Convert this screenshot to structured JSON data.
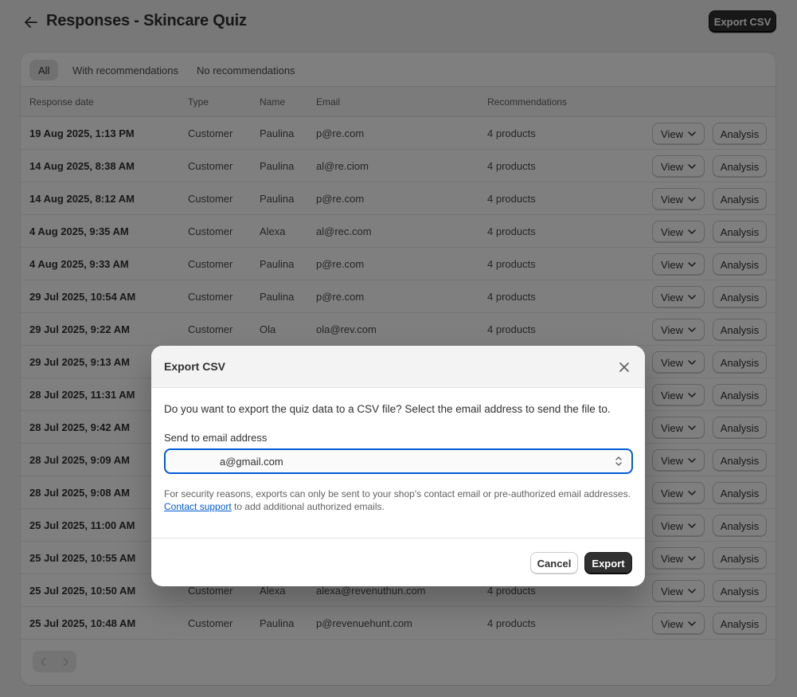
{
  "header": {
    "title": "Responses - Skincare Quiz",
    "export_label": "Export CSV"
  },
  "tabs": [
    "All",
    "With recommendations",
    "No recommendations"
  ],
  "columns": [
    "Response date",
    "Type",
    "Name",
    "Email",
    "Recommendations"
  ],
  "row_actions": {
    "view_label": "View",
    "analysis_label": "Analysis"
  },
  "rows": [
    {
      "date": "19 Aug 2025, 1:13 PM",
      "type": "Customer",
      "name": "Paulina",
      "email": "p@re.com",
      "recs": "4 products"
    },
    {
      "date": "14 Aug 2025, 8:38 AM",
      "type": "Customer",
      "name": "Paulina",
      "email": "al@re.ciom",
      "recs": "4 products"
    },
    {
      "date": "14 Aug 2025, 8:12 AM",
      "type": "Customer",
      "name": "Paulina",
      "email": "p@re.com",
      "recs": "4 products"
    },
    {
      "date": "4 Aug 2025, 9:35 AM",
      "type": "Customer",
      "name": "Alexa",
      "email": "al@rec.com",
      "recs": "4 products"
    },
    {
      "date": "4 Aug 2025, 9:33 AM",
      "type": "Customer",
      "name": "Paulina",
      "email": "p@re.com",
      "recs": "4 products"
    },
    {
      "date": "29 Jul 2025, 10:54 AM",
      "type": "Customer",
      "name": "Paulina",
      "email": "p@re.com",
      "recs": "4 products"
    },
    {
      "date": "29 Jul 2025, 9:22 AM",
      "type": "Customer",
      "name": "Ola",
      "email": "ola@rev.com",
      "recs": "4 products"
    },
    {
      "date": "29 Jul 2025, 9:13 AM",
      "type": "",
      "name": "",
      "email": "",
      "recs": ""
    },
    {
      "date": "28 Jul 2025, 11:31 AM",
      "type": "",
      "name": "",
      "email": "",
      "recs": ""
    },
    {
      "date": "28 Jul 2025, 9:42 AM",
      "type": "",
      "name": "",
      "email": "",
      "recs": ""
    },
    {
      "date": "28 Jul 2025, 9:09 AM",
      "type": "",
      "name": "",
      "email": "",
      "recs": ""
    },
    {
      "date": "28 Jul 2025, 9:08 AM",
      "type": "",
      "name": "",
      "email": "",
      "recs": ""
    },
    {
      "date": "25 Jul 2025, 11:00 AM",
      "type": "",
      "name": "",
      "email": "",
      "recs": ""
    },
    {
      "date": "25 Jul 2025, 10:55 AM",
      "type": "",
      "name": "",
      "email": "",
      "recs": ""
    },
    {
      "date": "25 Jul 2025, 10:50 AM",
      "type": "Customer",
      "name": "Alexa",
      "email": "alexa@revenuthun.com",
      "recs": "4 products"
    },
    {
      "date": "25 Jul 2025, 10:48 AM",
      "type": "Customer",
      "name": "Paulina",
      "email": "p@revenuehunt.com",
      "recs": "4 products"
    }
  ],
  "modal": {
    "title": "Export CSV",
    "description": "Do you want to export the quiz data to a CSV file? Select the email address to send the file to.",
    "field_label": "Send to email address",
    "selected_email": "a@gmail.com",
    "help_text": "For security reasons, exports can only be sent to your shop's contact email or pre-authorized email addresses.",
    "help_link": "Contact support",
    "help_suffix": " to add additional authorized emails.",
    "cancel_label": "Cancel",
    "export_label": "Export"
  }
}
